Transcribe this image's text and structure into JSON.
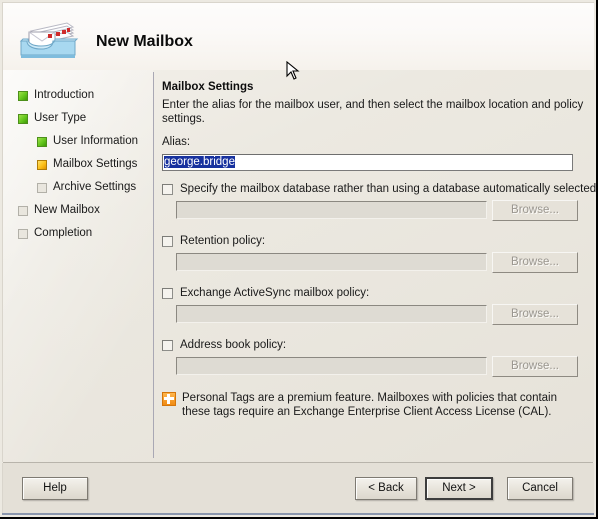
{
  "window": {
    "title": "New Mailbox",
    "icon": "mailbox-tray-icon",
    "accent_done_color": "#63c51c",
    "accent_current_color": "#fcc018",
    "selection_color": "#17319e",
    "note_icon_color": "#f08a12"
  },
  "sidebar": {
    "items": [
      {
        "label": "Introduction",
        "state": "done",
        "level": 0
      },
      {
        "label": "User Type",
        "state": "done",
        "level": 0
      },
      {
        "label": "User Information",
        "state": "done",
        "level": 1
      },
      {
        "label": "Mailbox Settings",
        "state": "current",
        "level": 1
      },
      {
        "label": "Archive Settings",
        "state": "todo",
        "level": 1
      },
      {
        "label": "New Mailbox",
        "state": "todo",
        "level": 0
      },
      {
        "label": "Completion",
        "state": "todo",
        "level": 0
      }
    ]
  },
  "content": {
    "heading": "Mailbox Settings",
    "description": "Enter the alias for the mailbox user, and then select the mailbox location and policy settings.",
    "alias": {
      "label": "Alias:",
      "value": "george.bridge",
      "placeholder": "",
      "selected": true
    },
    "options": [
      {
        "label": "Specify the mailbox database rather than using a database automatically selected:",
        "checked": false,
        "value": "",
        "placeholder": "",
        "browse_label": "Browse...",
        "enabled": false
      },
      {
        "label": "Retention policy:",
        "checked": false,
        "value": "",
        "placeholder": "",
        "browse_label": "Browse...",
        "enabled": false
      },
      {
        "label": "Exchange ActiveSync mailbox policy:",
        "checked": false,
        "value": "",
        "placeholder": "",
        "browse_label": "Browse...",
        "enabled": false
      },
      {
        "label": "Address book policy:",
        "checked": false,
        "value": "",
        "placeholder": "",
        "browse_label": "Browse...",
        "enabled": false
      }
    ],
    "note": {
      "icon": "premium-feature-icon",
      "text": "Personal Tags are a premium feature. Mailboxes with policies that contain these tags require an Exchange Enterprise Client Access License (CAL)."
    }
  },
  "footer": {
    "help_label": "Help",
    "back_label": "< Back",
    "next_label": "Next >",
    "cancel_label": "Cancel",
    "default_button": "next"
  }
}
